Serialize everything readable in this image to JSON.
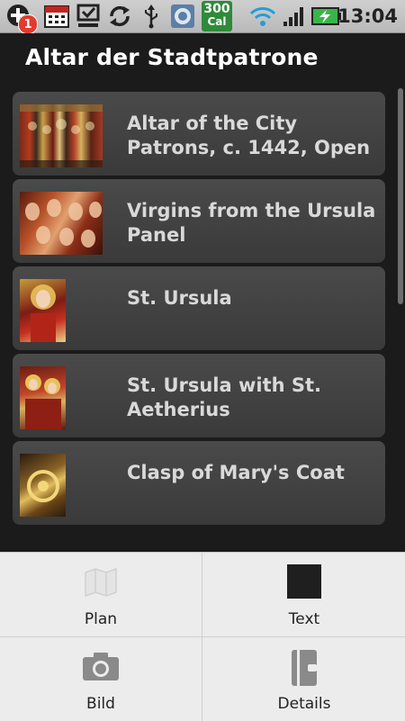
{
  "status_bar": {
    "notification_count": "1",
    "calories_value": "300",
    "calories_unit": "Cal",
    "time": "13:04"
  },
  "title": "Altar der Stadtpatrone",
  "items": [
    {
      "label": "Altar of the City Patrons, c. 1442, Open",
      "thumb": "altar-thumbnail"
    },
    {
      "label": "Virgins from the Ursula Panel",
      "thumb": "virgins-thumbnail"
    },
    {
      "label": "St. Ursula",
      "thumb": "ursula-thumbnail"
    },
    {
      "label": "St. Ursula with St. Aetherius",
      "thumb": "ursula-aetherius-thumbnail"
    },
    {
      "label": "Clasp of Mary's Coat",
      "thumb": "clasp-thumbnail"
    }
  ],
  "menu": {
    "plan": "Plan",
    "text": "Text",
    "bild": "Bild",
    "details": "Details"
  },
  "icons": [
    "plus-icon",
    "calendar-icon",
    "download-icon",
    "sync-icon",
    "usb-icon",
    "settings-icon",
    "wifi-icon",
    "signal-icon",
    "battery-icon",
    "map-icon",
    "camera-icon",
    "details-icon"
  ]
}
